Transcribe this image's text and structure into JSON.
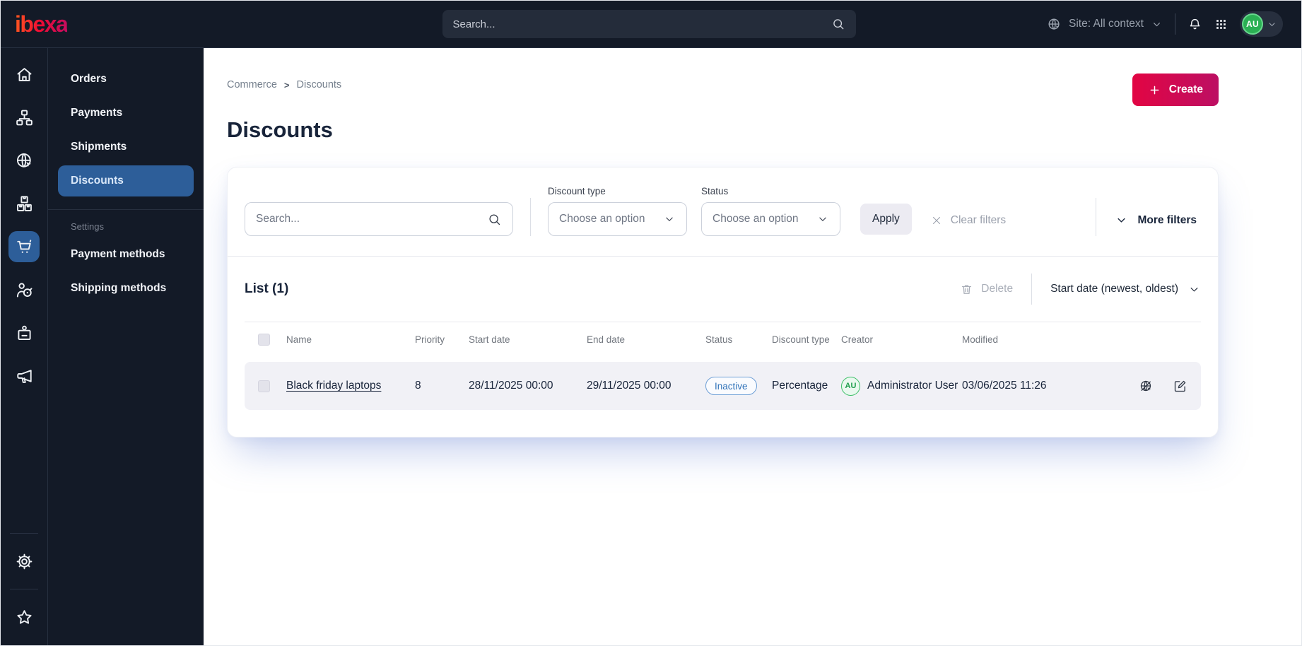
{
  "topbar": {
    "logo": "ibexa",
    "search_placeholder": "Search...",
    "site_selector": "Site: All context",
    "avatar_initials": "AU"
  },
  "rail_icons": [
    "home",
    "content-tree",
    "site",
    "product-catalog",
    "commerce",
    "customer-target",
    "id-badge",
    "megaphone",
    "settings-gear",
    "bookmarks-star"
  ],
  "menu": {
    "items": [
      "Orders",
      "Payments",
      "Shipments",
      "Discounts"
    ],
    "active_item": "Discounts",
    "settings_heading": "Settings",
    "settings_items": [
      "Payment methods",
      "Shipping methods"
    ]
  },
  "page": {
    "breadcrumb": [
      "Commerce",
      "Discounts"
    ],
    "breadcrumb_separator": ">",
    "title": "Discounts",
    "create_label": "Create"
  },
  "filters": {
    "search_placeholder": "Search...",
    "discount_type": {
      "label": "Discount type",
      "value": "Choose an option"
    },
    "status": {
      "label": "Status",
      "value": "Choose an option"
    },
    "apply_label": "Apply",
    "clear_label": "Clear filters",
    "more_label": "More filters"
  },
  "list": {
    "title": "List (1)",
    "delete_label": "Delete",
    "sort_label": "Start date (newest, oldest)",
    "columns": [
      "Name",
      "Priority",
      "Start date",
      "End date",
      "Status",
      "Discount type",
      "Creator",
      "Modified"
    ],
    "rows": [
      {
        "name": "Black friday laptops",
        "priority": "8",
        "start_date": "28/11/2025 00:00",
        "end_date": "29/11/2025 00:00",
        "status": "Inactive",
        "discount_type": "Percentage",
        "creator_initials": "AU",
        "creator_name": "Administrator User",
        "modified": "03/06/2025 11:26"
      }
    ]
  },
  "colors": {
    "topbar_bg": "#131a27",
    "accent_gradient_start": "#e20543",
    "accent_gradient_end": "#bc0f63",
    "active_nav_bg": "#2d5e99",
    "inactive_badge_text": "#3173b9",
    "inactive_badge_border": "#6e9fd6",
    "creator_avatar_green": "#3bbf66",
    "row_bg": "#f1f1f6"
  }
}
